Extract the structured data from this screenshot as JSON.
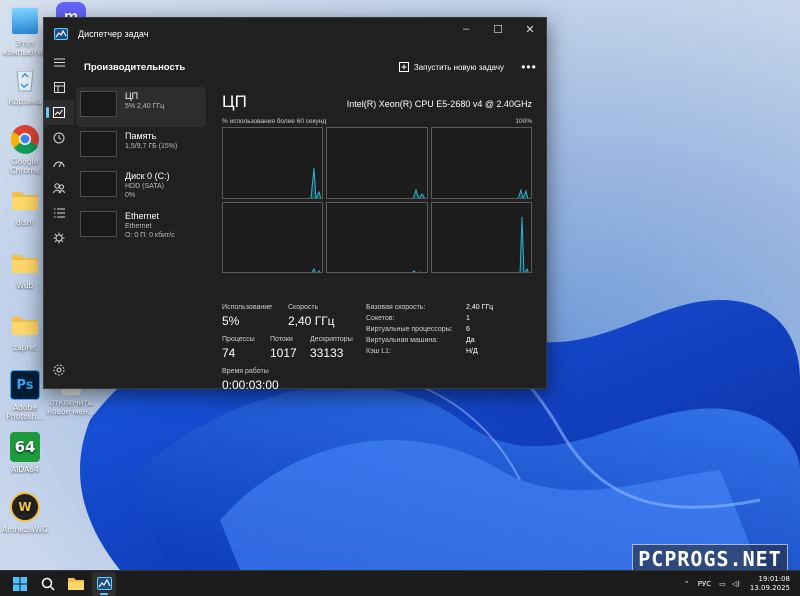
{
  "desktop": {
    "icons": [
      {
        "label": "Этот компьютер",
        "icon": "monitor-icon"
      },
      {
        "label": "Корзина",
        "icon": "recycle-bin-icon"
      },
      {
        "label": "Google Chrome",
        "icon": "chrome-icon"
      },
      {
        "label": "dism",
        "icon": "folder-icon"
      },
      {
        "label": "Wub",
        "icon": "folder-icon"
      },
      {
        "label": "zapret",
        "icon": "folder-icon"
      },
      {
        "label": "Adobe Photosh...",
        "icon": "photoshop-icon"
      },
      {
        "label": "AIDA64",
        "icon": "aida64-icon"
      },
      {
        "label": "AmneziaWG",
        "icon": "amneziawg-icon"
      },
      {
        "label": "отключить новое мен...",
        "icon": "shortcut-icon"
      }
    ]
  },
  "window": {
    "title": "Диспетчер задач",
    "section_title": "Производительность",
    "new_task_label": "Запустить новую задачу",
    "more_label": "•••"
  },
  "devices": [
    {
      "name": "ЦП",
      "sub1": "5% 2,40 ГГц",
      "sub2": ""
    },
    {
      "name": "Память",
      "sub1": "1,5/9,7 ГБ (15%)",
      "sub2": ""
    },
    {
      "name": "Диск 0 (C:)",
      "sub1": "HDD (SATA)",
      "sub2": "0%"
    },
    {
      "name": "Ethernet",
      "sub1": "Ethernet",
      "sub2": "О: 0 П: 0 кбит/с"
    }
  ],
  "cpu": {
    "title": "ЦП",
    "model": "Intel(R) Xeon(R) CPU E5-2680 v4 @ 2.40GHz",
    "axis_left": "% использования более 60 секунд",
    "axis_right": "100%",
    "usage_label": "Использование",
    "usage_value": "5%",
    "speed_label": "Скорость",
    "speed_value": "2,40 ГГц",
    "processes_label": "Процессы",
    "processes_value": "74",
    "threads_label": "Потоки",
    "threads_value": "1017",
    "handles_label": "Дескрипторы",
    "handles_value": "33133",
    "uptime_label": "Время работы",
    "uptime_value": "0:00:03:00",
    "specs": [
      {
        "k": "Базовая скорость:",
        "v": "2,40 ГГц"
      },
      {
        "k": "Сокетов:",
        "v": "1"
      },
      {
        "k": "Виртуальные процессоры:",
        "v": "6"
      },
      {
        "k": "Виртуальная машина:",
        "v": "Да"
      },
      {
        "k": "Кэш L1:",
        "v": "Н/Д"
      }
    ]
  },
  "taskbar": {
    "lang": "РУС",
    "time": "19:01:08",
    "date": "13.09.2025"
  },
  "watermark": "PCPROGS.NET",
  "colors": {
    "accent": "#60cdff",
    "graph_line": "#2ab4d4",
    "window_bg": "#202020"
  }
}
